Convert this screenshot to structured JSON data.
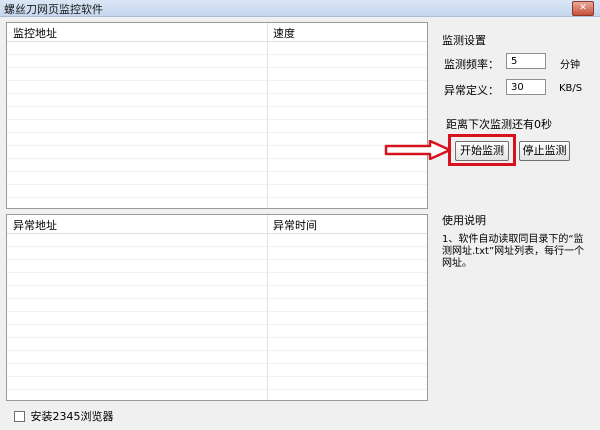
{
  "window": {
    "title": "螺丝刀网页监控软件",
    "close_symbol": "✕"
  },
  "monitor_list": {
    "columns": [
      "监控地址",
      "速度"
    ]
  },
  "error_list": {
    "columns": [
      "异常地址",
      "异常时间"
    ]
  },
  "settings": {
    "section_title": "监测设置",
    "frequency_label": "监测频率：",
    "frequency_value": "5",
    "frequency_unit": "分钟",
    "anomaly_label": "异常定义：",
    "anomaly_value": "30",
    "anomaly_unit": "KB/S",
    "countdown_text": "距离下次监测还有0秒",
    "start_button": "开始监测",
    "stop_button": "停止监测"
  },
  "usage": {
    "title": "使用说明",
    "text": "1、软件自动读取同目录下的“监测网址.txt”网址列表，每行一个网址。"
  },
  "footer": {
    "checkbox_label": "安装2345浏览器",
    "checked": false
  },
  "colors": {
    "highlight": "#d5121e",
    "titlebar": "#c5d7ee"
  }
}
